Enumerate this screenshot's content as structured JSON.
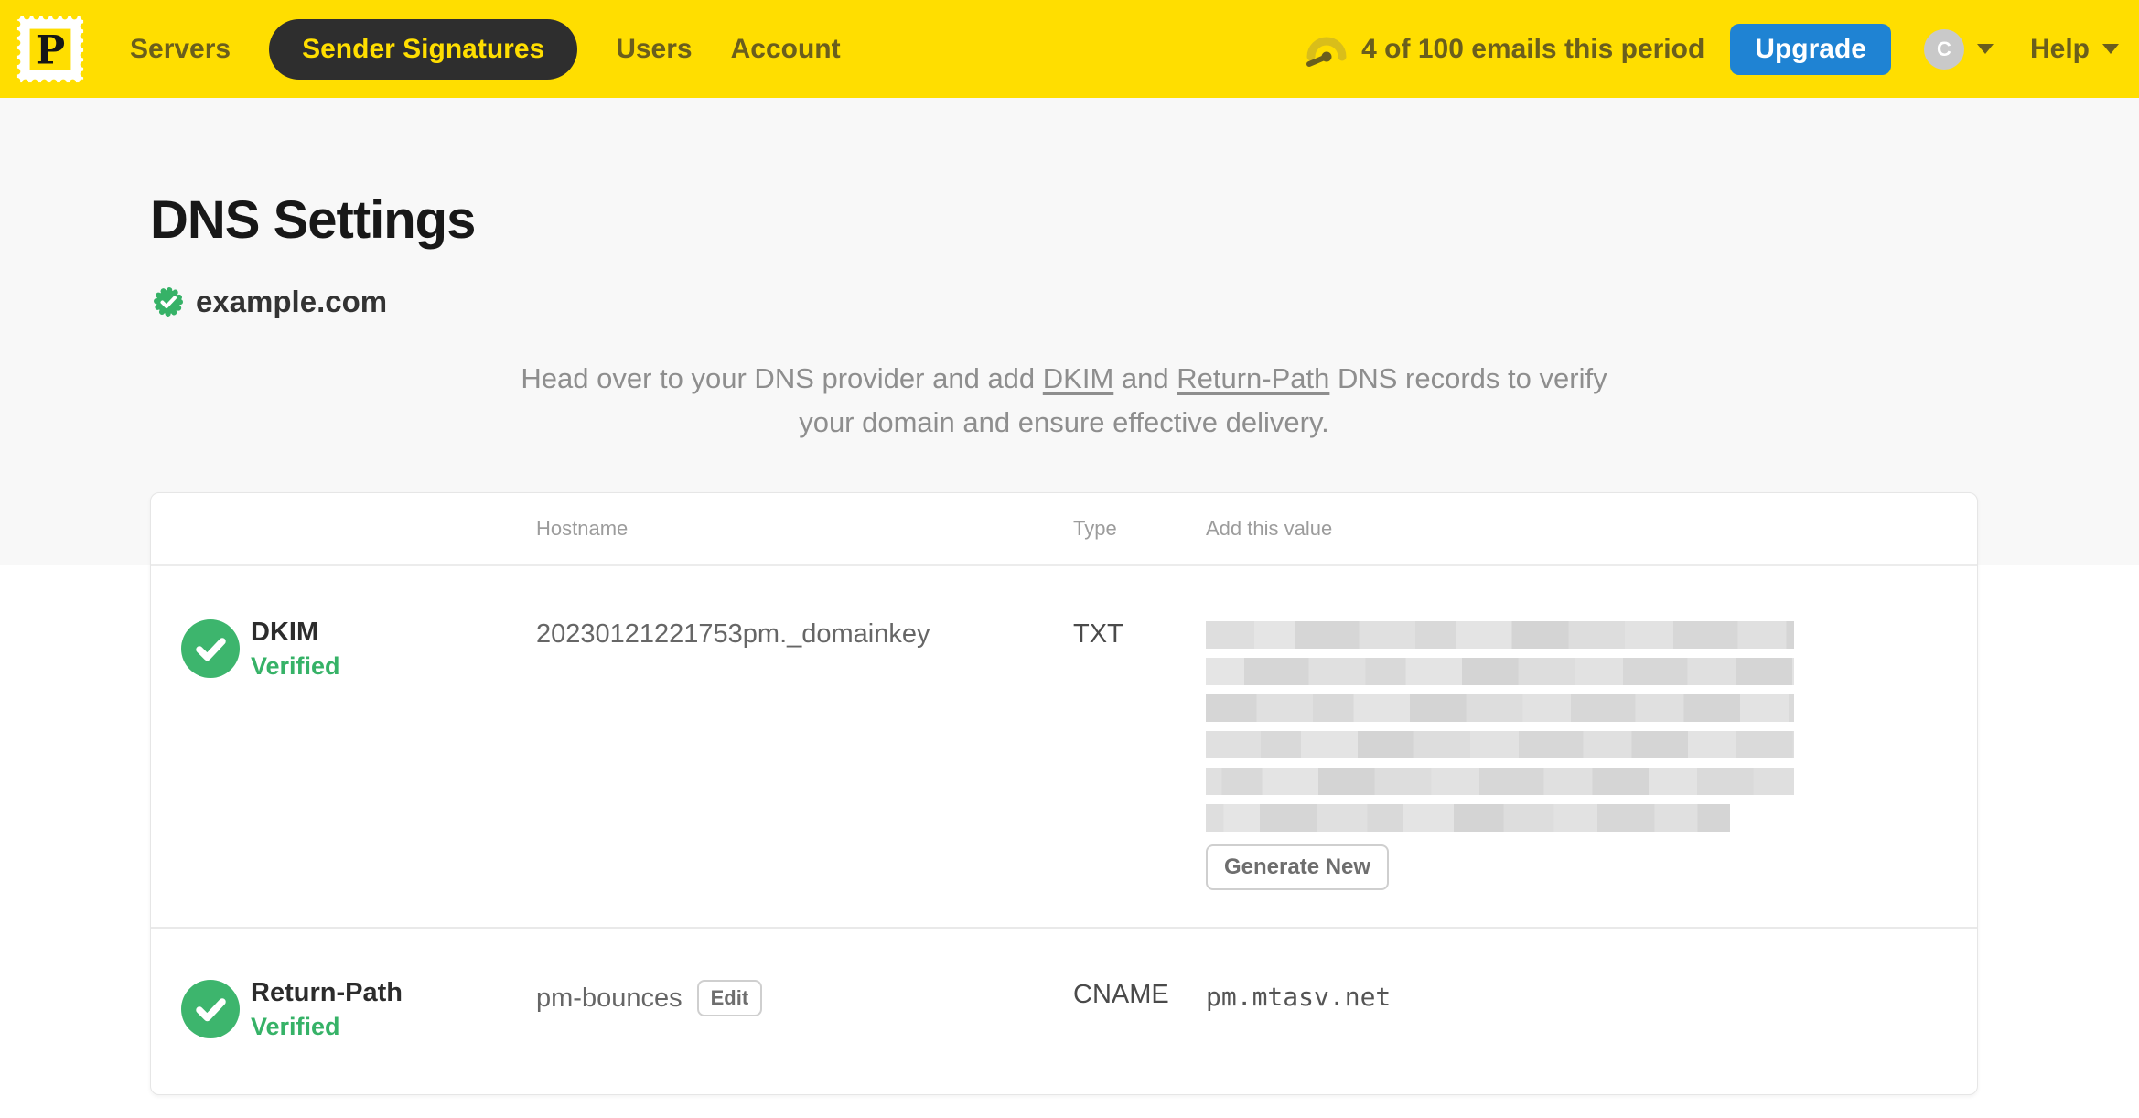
{
  "nav": {
    "brand_letter": "P",
    "items": [
      {
        "label": "Servers",
        "active": false
      },
      {
        "label": "Sender Signatures",
        "active": true
      },
      {
        "label": "Users",
        "active": false
      },
      {
        "label": "Account",
        "active": false
      }
    ],
    "usage_text": "4 of 100 emails this period",
    "upgrade_label": "Upgrade",
    "avatar_initial": "C",
    "help_label": "Help"
  },
  "page": {
    "title": "DNS Settings",
    "domain": "example.com",
    "intro_part1": "Head over to your DNS provider and add ",
    "intro_link_dkim": "DKIM",
    "intro_part2": " and ",
    "intro_link_return_path": "Return-Path",
    "intro_part3": " DNS records to verify your domain and ensure effective delivery."
  },
  "table": {
    "headers": {
      "hostname": "Hostname",
      "type": "Type",
      "value": "Add this value"
    },
    "rows": [
      {
        "name": "DKIM",
        "status": "Verified",
        "hostname": "20230121221753pm._domainkey",
        "type": "TXT",
        "value_display": "redacted",
        "action_label": "Generate New"
      },
      {
        "name": "Return-Path",
        "status": "Verified",
        "hostname": "pm-bounces",
        "edit_label": "Edit",
        "type": "CNAME",
        "value": "pm.mtasv.net"
      }
    ]
  },
  "colors": {
    "brand_yellow": "#FFDE00",
    "nav_text": "#6a5e1d",
    "active_pill_bg": "#2e2e2e",
    "upgrade_blue": "#1f83d3",
    "success_green": "#36b267"
  }
}
